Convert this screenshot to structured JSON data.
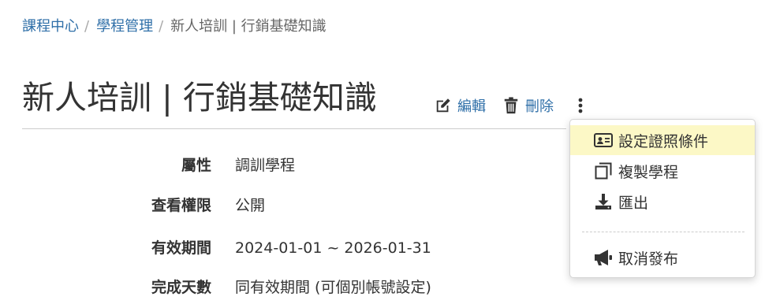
{
  "breadcrumb": {
    "items": [
      "課程中心",
      "學程管理"
    ],
    "separator": "/",
    "current": "新人培訓 | 行銷基礎知識"
  },
  "header": {
    "title": "新人培訓 | 行銷基礎知識",
    "edit_label": "編輯",
    "delete_label": "刪除",
    "edit_icon": "edit-icon",
    "delete_icon": "trash-icon",
    "more_icon": "kebab-icon"
  },
  "details": {
    "rows": [
      {
        "label": "屬性",
        "value": "調訓學程"
      },
      {
        "label": "查看權限",
        "value": "公開"
      },
      {
        "label": "有效期間",
        "value": "2024-01-01 ~ 2026-01-31"
      },
      {
        "label": "完成天數",
        "value": "同有效期間 (可個別帳號設定)"
      }
    ]
  },
  "menu": {
    "items": [
      {
        "label": "設定證照條件",
        "icon": "id-card-icon",
        "highlighted": true
      },
      {
        "label": "複製學程",
        "icon": "copy-icon"
      },
      {
        "label": "匯出",
        "icon": "download-icon"
      },
      {
        "label": "取消發布",
        "icon": "megaphone-icon"
      }
    ]
  },
  "colors": {
    "link": "#2f6fa8",
    "text": "#333333",
    "highlight": "#fcf8c6"
  }
}
